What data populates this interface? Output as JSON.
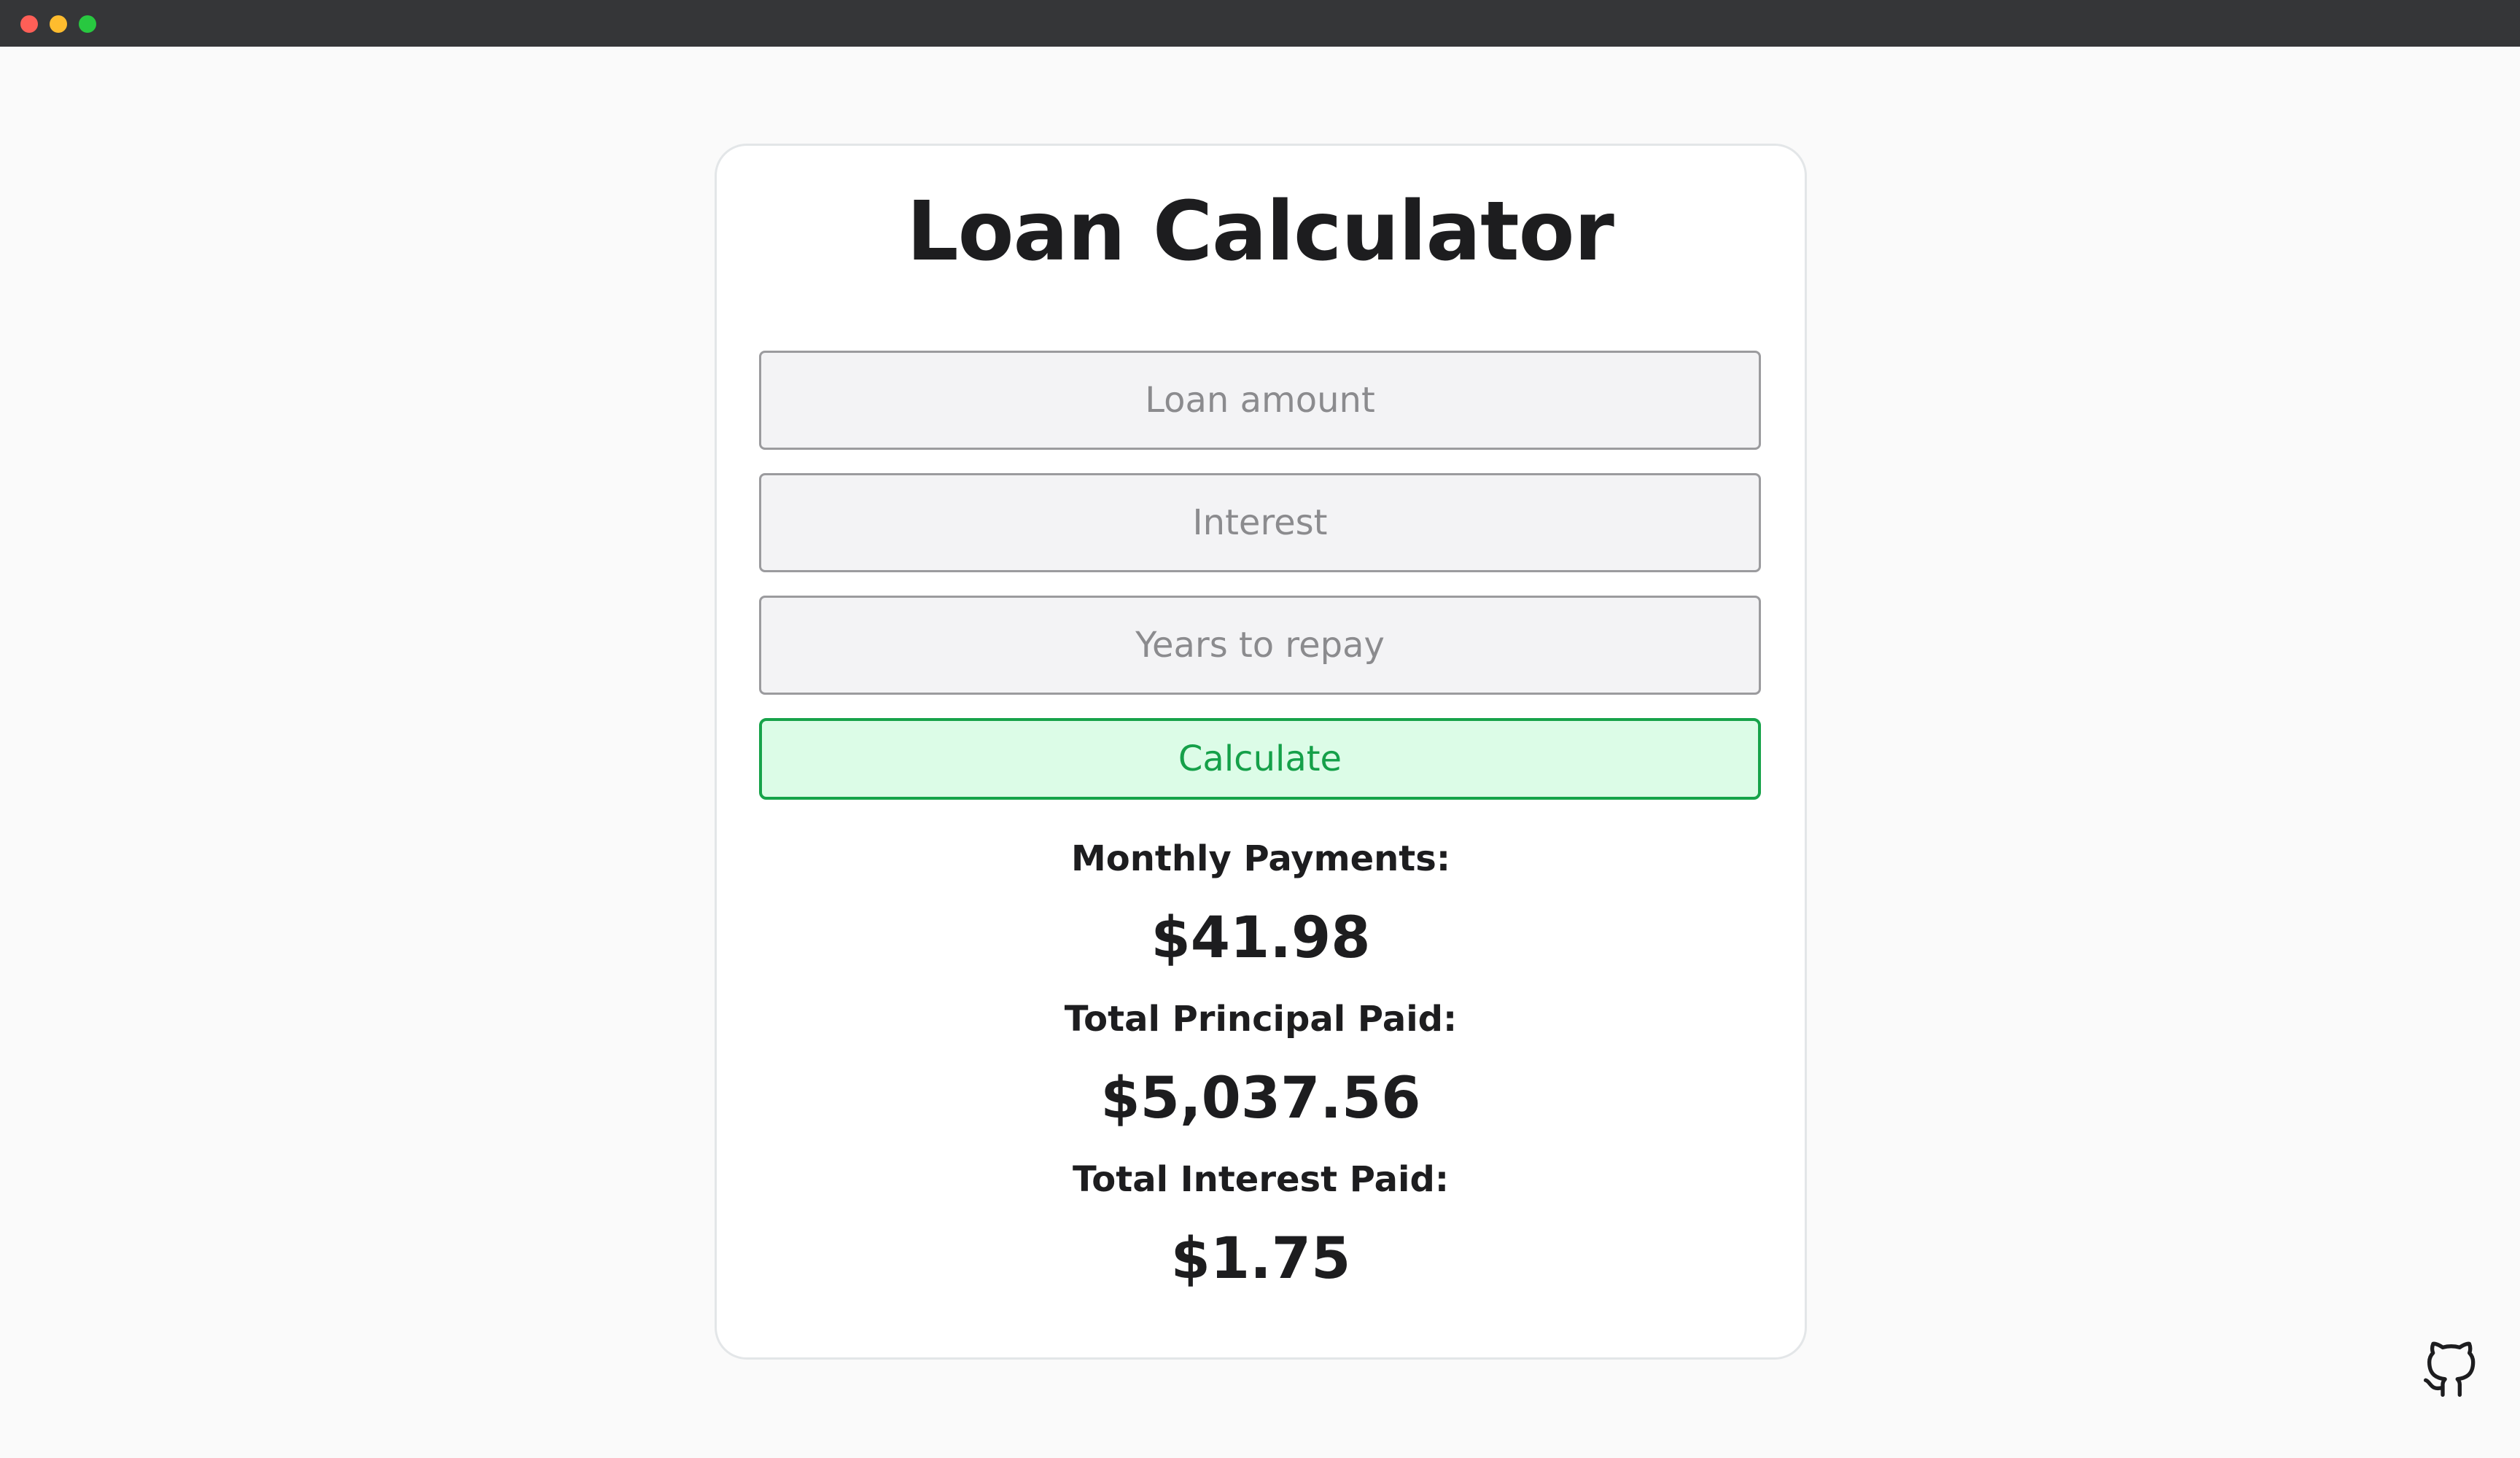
{
  "window": {
    "controls": {
      "close_color": "#ff5f57",
      "minimize_color": "#febc2e",
      "maximize_color": "#28c840"
    }
  },
  "calculator": {
    "title": "Loan Calculator",
    "fields": {
      "amount": {
        "placeholder": "Loan amount",
        "value": ""
      },
      "interest": {
        "placeholder": "Interest",
        "value": ""
      },
      "years": {
        "placeholder": "Years to repay",
        "value": ""
      }
    },
    "calculate_label": "Calculate",
    "results": {
      "monthly_label": "Monthly Payments:",
      "monthly_value": "$41.98",
      "principal_label": "Total Principal Paid:",
      "principal_value": "$5,037.56",
      "interest_label": "Total Interest Paid:",
      "interest_value": "$1.75"
    }
  },
  "footer": {
    "github_icon": "github-icon"
  },
  "colors": {
    "accent_green": "#17a34a",
    "button_bg": "#dcfce7",
    "page_bg": "#fafafa",
    "titlebar_bg": "#353638"
  }
}
